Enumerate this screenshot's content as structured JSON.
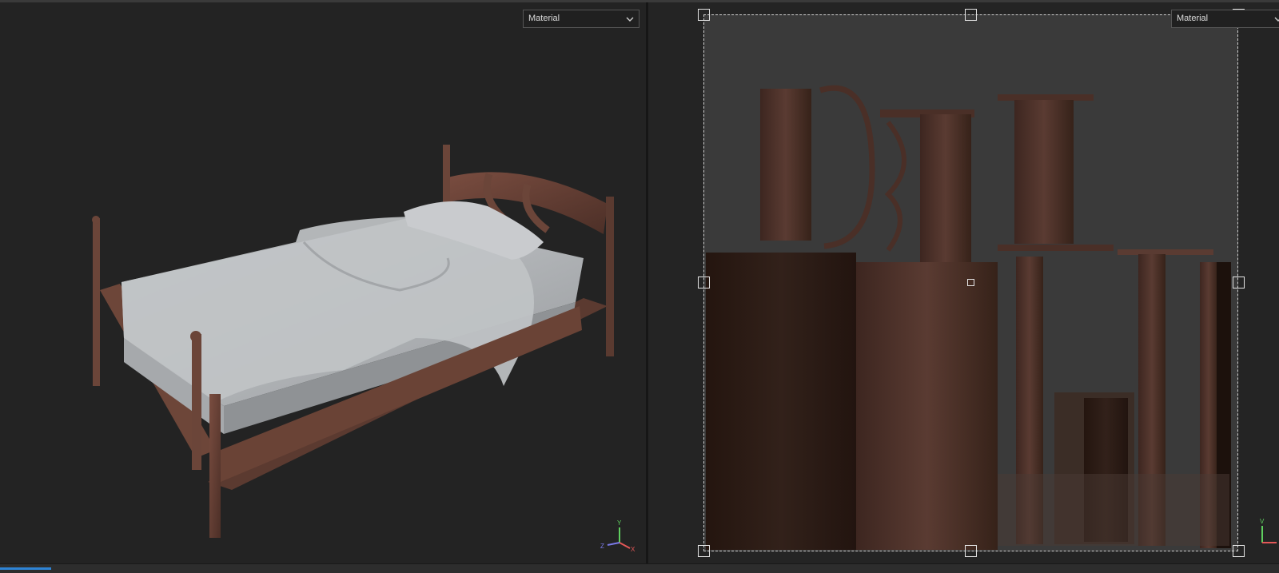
{
  "viewport_3d": {
    "shading_mode": "Material",
    "model": "bed",
    "axes": {
      "y": "Y",
      "z": "Z",
      "x": "X"
    }
  },
  "viewport_uv": {
    "shading_mode": "Material",
    "axes": {
      "v": "V"
    }
  },
  "icons": {
    "dropdown": "chevron-down-icon",
    "gizmo": "axis-gizmo-icon"
  },
  "colors": {
    "accent": "#2e84d6",
    "wood": "#6b4539",
    "sheet": "#b9bdc0",
    "axis_y": "#5fcf5f",
    "axis_x": "#e35757",
    "axis_z": "#7b7bea"
  },
  "status": {
    "progress": 0.04
  }
}
